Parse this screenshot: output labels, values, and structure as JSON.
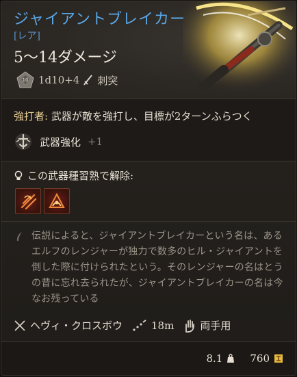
{
  "item": {
    "name": "ジャイアントブレイカー",
    "rarity": "[レア]",
    "damage": "5〜14ダメージ",
    "dice": "1d10+4",
    "damage_type": "刺突"
  },
  "effect": {
    "name": "強打者:",
    "text": " 武器が敵を強打し、目標が2ターンふらつく"
  },
  "skill": {
    "label": "武器強化",
    "bonus": "+1"
  },
  "proficiency": {
    "label": "この武器種習熟で解除:",
    "actions": [
      {
        "icon": "flame-slash-action-icon"
      },
      {
        "icon": "flame-hood-action-icon"
      }
    ]
  },
  "lore": "伝説によると、ジャイアントブレイカーという名は、あるエルフのレンジャーが独力で数多のヒル・ジャイアントを倒した際に付けられたという。そのレンジャーの名はとうの昔に忘れ去られたが、ジャイアントブレイカーの名は今なお残っている",
  "properties": {
    "weapon_type": "ヘヴィ・クロスボウ",
    "range": "18m",
    "handedness": "両手用"
  },
  "footer": {
    "weight": "8.1",
    "price": "760"
  },
  "colors": {
    "rare_blue": "#5aa7e6",
    "effect_gold": "#e9cf96",
    "lore_gray": "#9c958a"
  }
}
